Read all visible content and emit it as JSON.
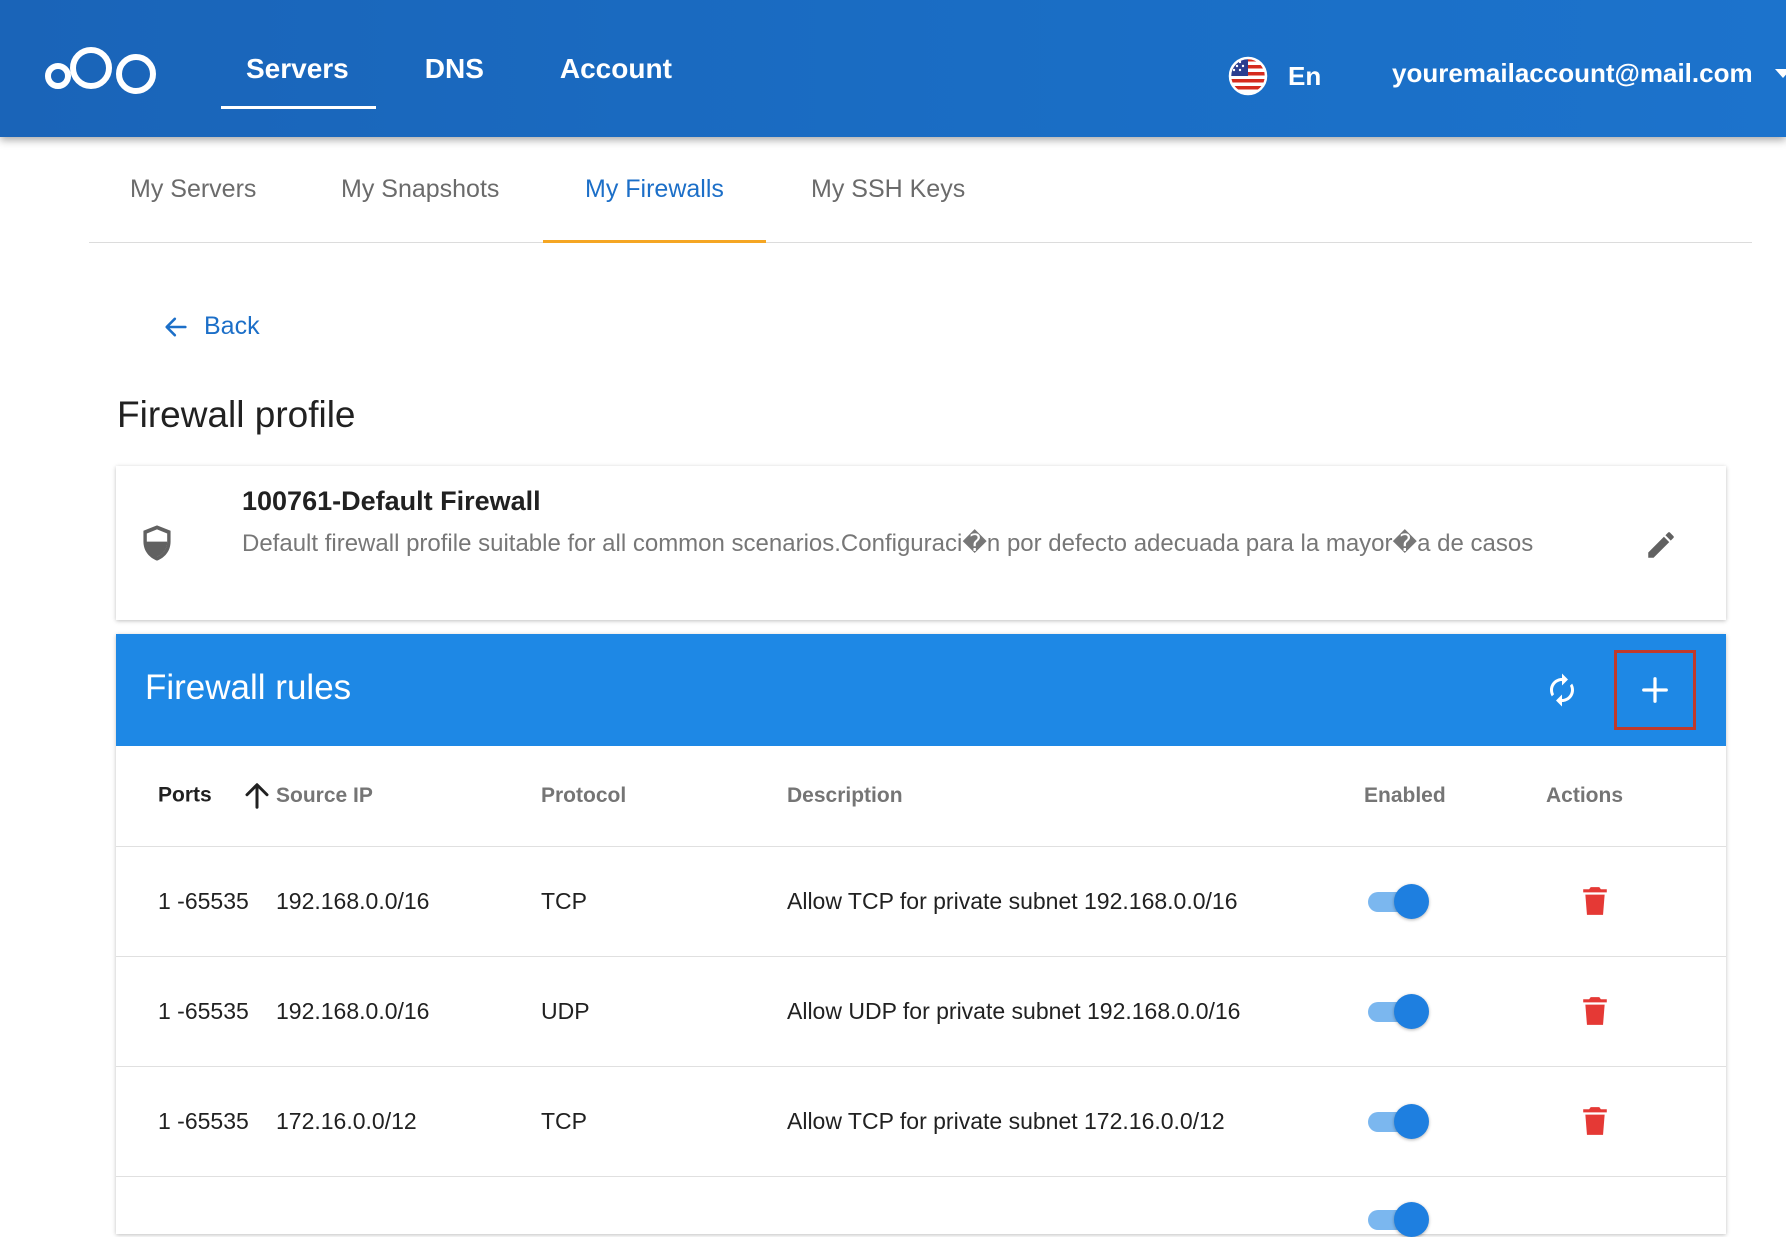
{
  "header": {
    "nav": [
      "Servers",
      "DNS",
      "Account"
    ],
    "active_nav": "Servers",
    "language": "En",
    "account_email": "youremailaccount@mail.com"
  },
  "subtabs": [
    "My Servers",
    "My Snapshots",
    "My Firewalls",
    "My SSH Keys"
  ],
  "active_subtab": "My Firewalls",
  "back_label": "Back",
  "page_title": "Firewall profile",
  "profile": {
    "name": "100761-Default Firewall",
    "description": "Default firewall profile suitable for all common scenarios.Configuraci�n por defecto adecuada para la mayor�a de casos"
  },
  "rules": {
    "title": "Firewall rules",
    "columns": [
      "Ports",
      "Source IP",
      "Protocol",
      "Description",
      "Enabled",
      "Actions"
    ],
    "rows": [
      {
        "ports": "1 -65535",
        "source_ip": "192.168.0.0/16",
        "protocol": "TCP",
        "description": "Allow TCP for private subnet 192.168.0.0/16",
        "enabled": true
      },
      {
        "ports": "1 -65535",
        "source_ip": "192.168.0.0/16",
        "protocol": "UDP",
        "description": "Allow UDP for private subnet 192.168.0.0/16",
        "enabled": true
      },
      {
        "ports": "1 -65535",
        "source_ip": "172.16.0.0/12",
        "protocol": "TCP",
        "description": "Allow TCP for private subnet 172.16.0.0/12",
        "enabled": true
      }
    ]
  },
  "icons": {
    "logo": "cloud-circles-logo",
    "flag": "us-flag-icon",
    "account_menu": "caret-down-icon",
    "back": "arrow-left-icon",
    "profile": "shield-icon",
    "edit": "pencil-icon",
    "refresh": "refresh-icon",
    "add": "plus-icon",
    "sort": "arrow-up-icon",
    "delete": "trash-icon"
  },
  "colors": {
    "header_bg": "#1a6dc4",
    "accent": "#1c6fc8",
    "active_tab_underline": "#f5a623",
    "rules_header_bg": "#1e88e5",
    "toggle_on": "#1e7fe0",
    "delete": "#e53935",
    "highlight_border": "#c0392b"
  }
}
